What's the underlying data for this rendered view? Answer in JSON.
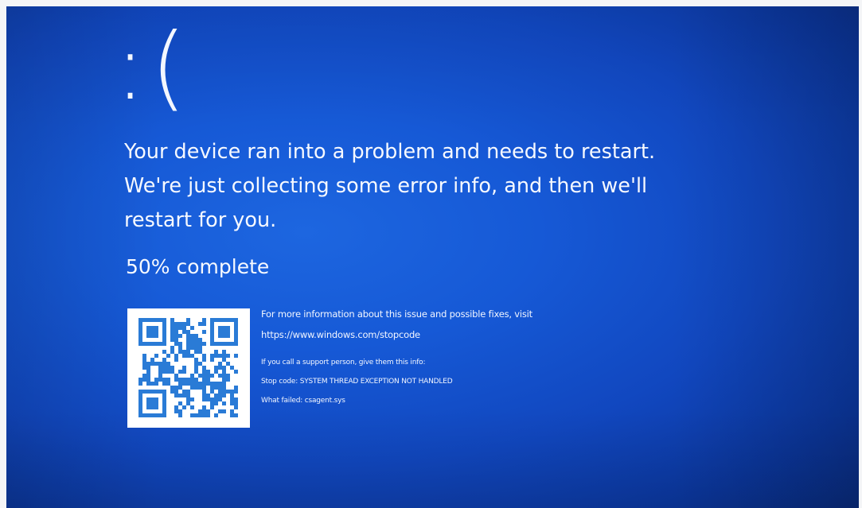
{
  "bsod": {
    "sad_face": ":(",
    "message_lines": [
      "Your device ran into a problem and needs to restart.",
      "We're just collecting some error info, and then we'll",
      "restart for you."
    ],
    "progress_text": "50% complete",
    "progress_percent": 50,
    "more_info": "For more information about this issue and possible fixes, visit",
    "url": "https://www.windows.com/stopcode",
    "support_line": "If you call a support person, give them this info:",
    "stop_code": "Stop code: SYSTEM THREAD EXCEPTION NOT HANDLED",
    "what_failed": "What failed: csagent.sys",
    "qr_icon": "qr-code-icon"
  },
  "colors": {
    "background": "#1659d6",
    "text": "#ffffff",
    "qr_module": "#2a7bd6"
  }
}
